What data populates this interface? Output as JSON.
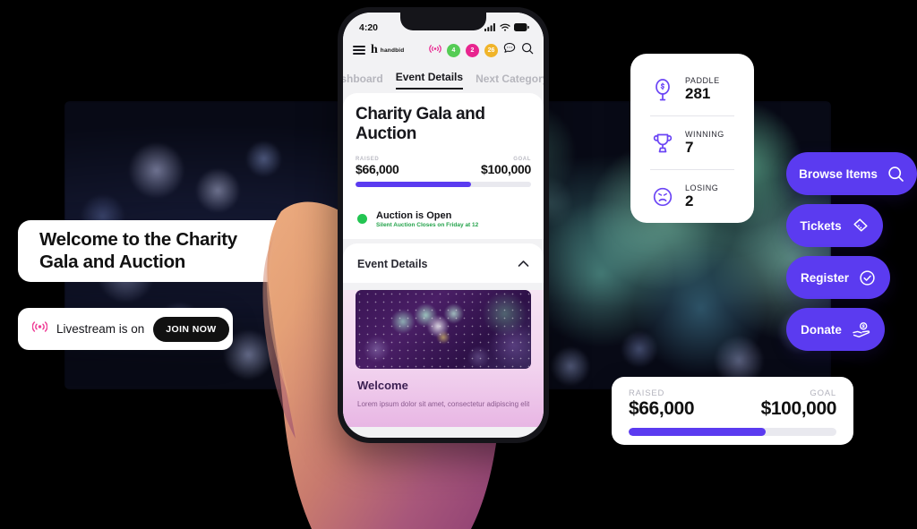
{
  "app": {
    "brand": "handbid",
    "brand_mark": "h"
  },
  "background": {
    "alt": "event bokeh lights photo"
  },
  "welcome_card": {
    "line1": "Welcome to the Charity",
    "line2": "Gala and Auction"
  },
  "livestream_card": {
    "icon": "broadcast-icon",
    "label": "Livestream is on",
    "button_label": "JOIN NOW",
    "icon_color": "#ef3d96"
  },
  "stats_card": {
    "rows": [
      {
        "icon": "paddle-dollar-icon",
        "label": "PADDLE",
        "value": "281"
      },
      {
        "icon": "trophy-icon",
        "label": "WINNING",
        "value": "7"
      },
      {
        "icon": "sad-face-icon",
        "label": "LOSING",
        "value": "2"
      }
    ]
  },
  "actions": [
    {
      "label": "Browse Items",
      "icon": "search-icon"
    },
    {
      "label": "Tickets",
      "icon": "ticket-icon"
    },
    {
      "label": "Register",
      "icon": "check-circle-icon"
    },
    {
      "label": "Donate",
      "icon": "hand-dollar-icon"
    }
  ],
  "raised_card": {
    "raised_label": "RAISED",
    "goal_label": "GOAL",
    "raised_value": "$66,000",
    "goal_value": "$100,000",
    "progress_percent": 66
  },
  "phone": {
    "status_bar": {
      "time": "4:20",
      "signal": "signal-icon",
      "wifi": "wifi-icon",
      "battery": "battery-icon"
    },
    "app_bar": {
      "menu": "hamburger-icon",
      "live": "broadcast-icon",
      "badges": [
        {
          "value": "4",
          "color": "#55cc55"
        },
        {
          "value": "2",
          "color": "#e8258f"
        },
        {
          "value": "26",
          "color": "#f0b429"
        }
      ],
      "chat": "chat-icon",
      "search": "search-icon"
    },
    "tabs": [
      {
        "label": "Dashboard",
        "active": false
      },
      {
        "label": "Event Details",
        "active": true
      },
      {
        "label": "Next Category",
        "active": false
      }
    ],
    "event": {
      "title": "Charity Gala and Auction",
      "raised_label": "RAISED",
      "goal_label": "GOAL",
      "raised_value": "$66,000",
      "goal_value": "$100,000",
      "progress_percent": 66
    },
    "auction_status": {
      "dot_color": "#23c552",
      "headline": "Auction is Open",
      "subline": "Silent Auction Closes on Friday at 12"
    },
    "section": {
      "title": "Event Details",
      "chevron": "chevron-up-icon"
    },
    "hero_image": {
      "alt": "purple bokeh balloons photo"
    },
    "welcome_section": {
      "title": "Welcome",
      "body": "Lorem ipsum dolor sit amet, consectetur adipiscing elit"
    }
  },
  "colors": {
    "accent_purple": "#5b3bf0",
    "green": "#23c552",
    "pink": "#e8258f",
    "amber": "#f0b429",
    "dark": "#15151a"
  }
}
